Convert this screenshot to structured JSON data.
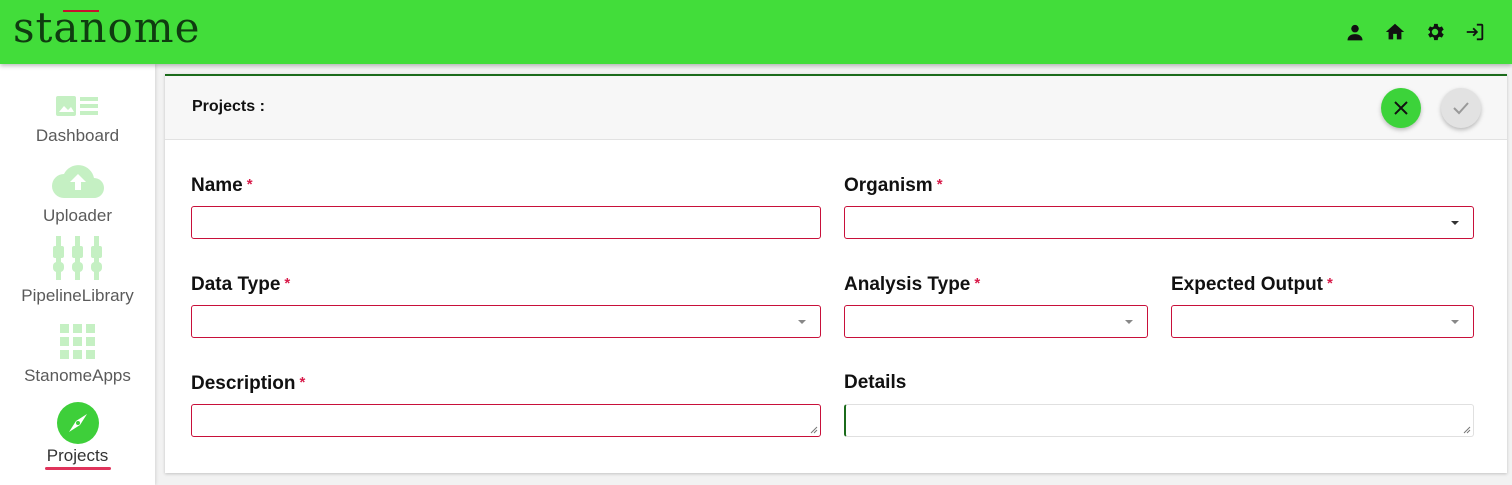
{
  "header": {
    "logo_text": "stanome",
    "icons": [
      "user-icon",
      "home-icon",
      "gear-icon",
      "logout-icon"
    ],
    "bg_color": "#42dd3a"
  },
  "sidebar": {
    "items": [
      {
        "label": "Dashboard",
        "icon": "dashboard-icon"
      },
      {
        "label": "Uploader",
        "icon": "cloud-upload-icon"
      },
      {
        "label": "PipelineLibrary",
        "icon": "pipeline-icon"
      },
      {
        "label": "StanomeApps",
        "icon": "apps-grid-icon"
      },
      {
        "label": "Projects",
        "icon": "compass-icon",
        "active": true
      }
    ]
  },
  "form": {
    "title": "Projects :",
    "required_mark": "*",
    "fields": {
      "name": {
        "label": "Name",
        "value": ""
      },
      "organism": {
        "label": "Organism",
        "value": ""
      },
      "data_type": {
        "label": "Data Type",
        "value": ""
      },
      "analysis_type": {
        "label": "Analysis Type",
        "value": ""
      },
      "expected_output": {
        "label": "Expected Output",
        "value": ""
      },
      "description": {
        "label": "Description",
        "value": ""
      },
      "details": {
        "label": "Details",
        "value": ""
      }
    },
    "actions": [
      "close-icon",
      "check-icon"
    ]
  },
  "colors": {
    "accent": "#42dd3a",
    "required": "#d81b4a",
    "border_error": "#c8103a",
    "active_underline": "#e0335b"
  }
}
